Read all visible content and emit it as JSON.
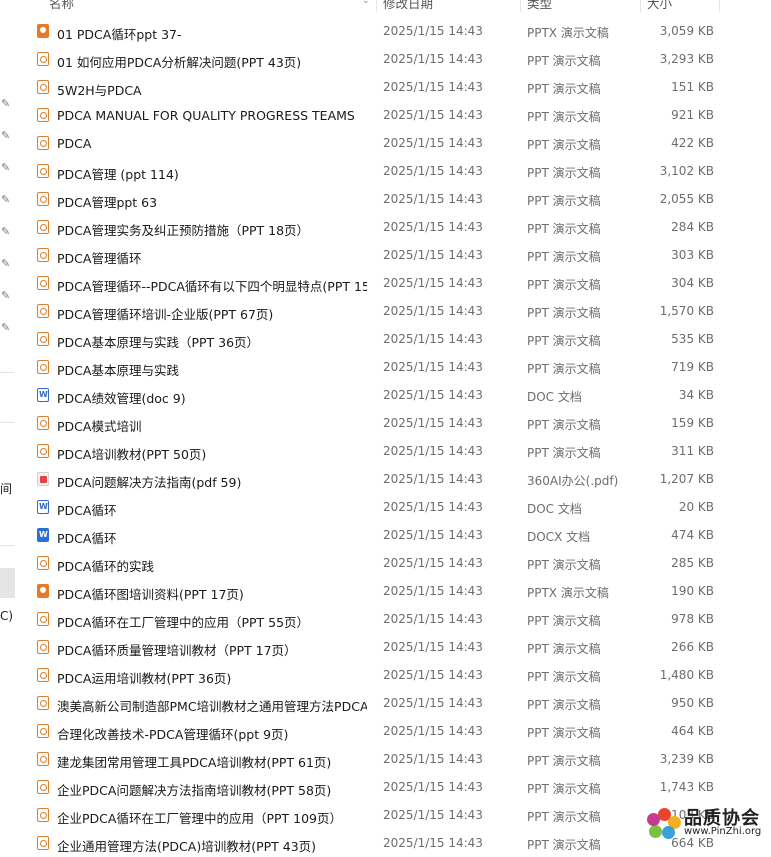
{
  "header": {
    "name": "名称",
    "date": "修改日期",
    "type": "类型",
    "size": "大小"
  },
  "nav": {
    "frag1": "间",
    "frag2": "C) ("
  },
  "files": [
    {
      "name": "01 PDCA循环ppt 37-",
      "date": "2025/1/15 14:43",
      "type": "PPTX 演示文稿",
      "size": "3,059 KB",
      "icon": "pptx"
    },
    {
      "name": "01 如何应用PDCA分析解决问题(PPT 43页)",
      "date": "2025/1/15 14:43",
      "type": "PPT 演示文稿",
      "size": "3,293 KB",
      "icon": "ppt"
    },
    {
      "name": "5W2H与PDCA",
      "date": "2025/1/15 14:43",
      "type": "PPT 演示文稿",
      "size": "151 KB",
      "icon": "ppt"
    },
    {
      "name": "PDCA MANUAL FOR QUALITY PROGRESS TEAMS",
      "date": "2025/1/15 14:43",
      "type": "PPT 演示文稿",
      "size": "921 KB",
      "icon": "ppt"
    },
    {
      "name": "PDCA",
      "date": "2025/1/15 14:43",
      "type": "PPT 演示文稿",
      "size": "422 KB",
      "icon": "ppt"
    },
    {
      "name": "PDCA管理 (ppt 114)",
      "date": "2025/1/15 14:43",
      "type": "PPT 演示文稿",
      "size": "3,102 KB",
      "icon": "ppt"
    },
    {
      "name": "PDCA管理ppt 63",
      "date": "2025/1/15 14:43",
      "type": "PPT 演示文稿",
      "size": "2,055 KB",
      "icon": "ppt"
    },
    {
      "name": "PDCA管理实务及纠正预防措施（PPT 18页）",
      "date": "2025/1/15 14:43",
      "type": "PPT 演示文稿",
      "size": "284 KB",
      "icon": "ppt"
    },
    {
      "name": "PDCA管理循环",
      "date": "2025/1/15 14:43",
      "type": "PPT 演示文稿",
      "size": "303 KB",
      "icon": "ppt"
    },
    {
      "name": "PDCA管理循环--PDCA循环有以下四个明显特点(PPT 15...",
      "date": "2025/1/15 14:43",
      "type": "PPT 演示文稿",
      "size": "304 KB",
      "icon": "ppt"
    },
    {
      "name": "PDCA管理循环培训-企业版(PPT 67页)",
      "date": "2025/1/15 14:43",
      "type": "PPT 演示文稿",
      "size": "1,570 KB",
      "icon": "ppt"
    },
    {
      "name": "PDCA基本原理与实践（PPT 36页）",
      "date": "2025/1/15 14:43",
      "type": "PPT 演示文稿",
      "size": "535 KB",
      "icon": "ppt"
    },
    {
      "name": "PDCA基本原理与实践",
      "date": "2025/1/15 14:43",
      "type": "PPT 演示文稿",
      "size": "719 KB",
      "icon": "ppt"
    },
    {
      "name": "PDCA绩效管理(doc 9)",
      "date": "2025/1/15 14:43",
      "type": "DOC 文档",
      "size": "34 KB",
      "icon": "doc"
    },
    {
      "name": "PDCA模式培训",
      "date": "2025/1/15 14:43",
      "type": "PPT 演示文稿",
      "size": "159 KB",
      "icon": "ppt"
    },
    {
      "name": "PDCA培训教材(PPT 50页)",
      "date": "2025/1/15 14:43",
      "type": "PPT 演示文稿",
      "size": "311 KB",
      "icon": "ppt"
    },
    {
      "name": "PDCA问题解决方法指南(pdf 59)",
      "date": "2025/1/15 14:43",
      "type": "360AI办公(.pdf)",
      "size": "1,207 KB",
      "icon": "pdf"
    },
    {
      "name": "PDCA循环",
      "date": "2025/1/15 14:43",
      "type": "DOC 文档",
      "size": "20 KB",
      "icon": "doc"
    },
    {
      "name": "PDCA循环",
      "date": "2025/1/15 14:43",
      "type": "DOCX 文档",
      "size": "474 KB",
      "icon": "docx"
    },
    {
      "name": "PDCA循环的实践",
      "date": "2025/1/15 14:43",
      "type": "PPT 演示文稿",
      "size": "285 KB",
      "icon": "ppt"
    },
    {
      "name": "PDCA循环图培训资料(PPT 17页)",
      "date": "2025/1/15 14:43",
      "type": "PPTX 演示文稿",
      "size": "190 KB",
      "icon": "pptx"
    },
    {
      "name": "PDCA循环在工厂管理中的应用（PPT 55页）",
      "date": "2025/1/15 14:43",
      "type": "PPT 演示文稿",
      "size": "978 KB",
      "icon": "ppt"
    },
    {
      "name": "PDCA循环质量管理培训教材（PPT 17页）",
      "date": "2025/1/15 14:43",
      "type": "PPT 演示文稿",
      "size": "266 KB",
      "icon": "ppt"
    },
    {
      "name": "PDCA运用培训教材(PPT 36页)",
      "date": "2025/1/15 14:43",
      "type": "PPT 演示文稿",
      "size": "1,480 KB",
      "icon": "ppt"
    },
    {
      "name": "澳美高新公司制造部PMC培训教材之通用管理方法PDCA...",
      "date": "2025/1/15 14:43",
      "type": "PPT 演示文稿",
      "size": "950 KB",
      "icon": "ppt"
    },
    {
      "name": "合理化改善技术-PDCA管理循环(ppt 9页)",
      "date": "2025/1/15 14:43",
      "type": "PPT 演示文稿",
      "size": "464 KB",
      "icon": "ppt"
    },
    {
      "name": "建龙集团常用管理工具PDCA培训教材(PPT 61页)",
      "date": "2025/1/15 14:43",
      "type": "PPT 演示文稿",
      "size": "3,239 KB",
      "icon": "ppt"
    },
    {
      "name": "企业PDCA问题解决方法指南培训教材(PPT 58页)",
      "date": "2025/1/15 14:43",
      "type": "PPT 演示文稿",
      "size": "1,743 KB",
      "icon": "ppt"
    },
    {
      "name": "企业PDCA循环在工厂管理中的应用（PPT 109页）",
      "date": "2025/1/15 14:43",
      "type": "PPT 演示文稿",
      "size": "1,103 KB",
      "icon": "ppt"
    },
    {
      "name": "企业通用管理方法(PDCA)培训教材(PPT 43页)",
      "date": "2025/1/15 14:43",
      "type": "PPT 演示文稿",
      "size": "664 KB",
      "icon": "ppt"
    }
  ],
  "watermark": {
    "text": "品质协会",
    "url": "www.PinZhi.org"
  }
}
